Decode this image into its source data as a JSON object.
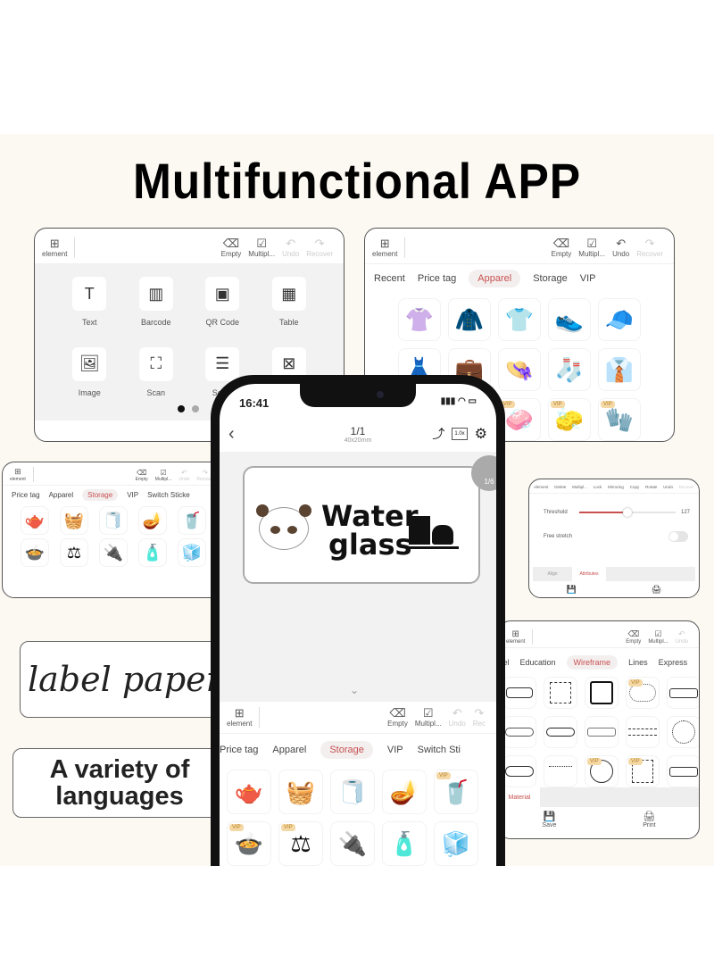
{
  "title": "Multifunctional APP",
  "card_elements": {
    "toolbar": {
      "element": "element",
      "empty": "Empty",
      "multiple": "Multipl...",
      "undo": "Undo",
      "recover": "Recover"
    },
    "items": [
      {
        "label": "Text",
        "icon": "T"
      },
      {
        "label": "Barcode",
        "icon": "▥"
      },
      {
        "label": "QR Code",
        "icon": "▣"
      },
      {
        "label": "Table",
        "icon": "▦"
      },
      {
        "label": "Image",
        "icon": "🖼"
      },
      {
        "label": "Scan",
        "icon": "⛶"
      },
      {
        "label": "Serial",
        "icon": "☰"
      },
      {
        "label": "",
        "icon": "⊠"
      }
    ]
  },
  "card_apparel": {
    "toolbar": {
      "element": "element",
      "empty": "Empty",
      "multiple": "Multipl...",
      "undo": "Undo",
      "recover": "Recover"
    },
    "tabs": [
      "Recent",
      "Price tag",
      "Apparel",
      "Storage",
      "VIP"
    ],
    "active_tab": "Apparel",
    "icons": [
      "👚",
      "🧥",
      "👕",
      "👟",
      "🧢",
      "👗",
      "💼",
      "👒",
      "🧦",
      "👔",
      "🧼",
      "🧽",
      "🧤"
    ],
    "vip_label": "VIP"
  },
  "card_storage_small": {
    "toolbar": {
      "element": "element",
      "empty": "Empty",
      "multiple": "Multipl...",
      "undo": "Undo",
      "recover": "Recover"
    },
    "tabs": [
      "Price tag",
      "Apparel",
      "Storage",
      "VIP",
      "Switch Sticke"
    ],
    "active_tab": "Storage"
  },
  "card_attributes": {
    "toolbar": [
      "element",
      "Delete",
      "Multipl...",
      "Lock",
      "Mirroring",
      "Copy",
      "Rotate",
      "Undo",
      "Recover"
    ],
    "threshold_label": "Threshold",
    "threshold_value": "127",
    "threshold_fraction": 0.5,
    "free_stretch_label": "Free stretch",
    "free_stretch_on": false,
    "tabs": [
      "Align",
      "Attributes"
    ],
    "active_tab": "Attributes"
  },
  "card_wireframe": {
    "toolbar": {
      "element": "element",
      "empty": "Empty",
      "multiple": "Multipl...",
      "undo": "Undo",
      "recover": "Recover"
    },
    "tabs": [
      "vel",
      "Education",
      "Wireframe",
      "Lines",
      "Express"
    ],
    "active_tab": "Wireframe",
    "material_label": "Material",
    "save": "Save",
    "print": "Print"
  },
  "captions": {
    "label_paper": "label paper",
    "languages": "A variety of languages"
  },
  "phone": {
    "time": "16:41",
    "page": "1/1",
    "size": "40x20mm",
    "zoom": "1.0x",
    "page_indicator": "1/6",
    "label_text_line1": "Water",
    "label_text_line2": "glass",
    "toolbar": {
      "element": "element",
      "empty": "Empty",
      "multiple": "Multipl...",
      "undo": "Undo",
      "recover": "Rec"
    },
    "tabs": [
      "Price tag",
      "Apparel",
      "Storage",
      "VIP",
      "Switch Sti"
    ],
    "active_tab": "Storage",
    "icons": [
      "🫖",
      "🧺",
      "🧻",
      "🪔",
      "🥤",
      "🍲",
      "⚖",
      "🔌",
      "🧴",
      "🧊"
    ],
    "vip_label": "VIP"
  },
  "colors": {
    "accent": "#c8504f",
    "background": "#fcf8f2",
    "vip": "#f4d9a6"
  }
}
